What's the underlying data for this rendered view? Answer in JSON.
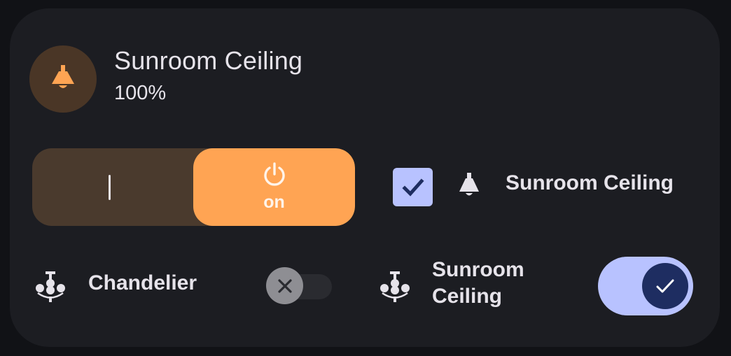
{
  "header": {
    "title": "Sunroom Ceiling",
    "brightness": "100%",
    "icon": "ceiling-lamp-icon",
    "accent_color": "#ffa453"
  },
  "power_switch": {
    "on_label": "on",
    "state": "on",
    "icon": "power-icon"
  },
  "checkbox_row": {
    "label": "Sunroom Ceiling",
    "checked": true,
    "icon": "ceiling-lamp-icon"
  },
  "chandelier_row": {
    "label": "Chandelier",
    "toggle_state": "off",
    "icon": "chandelier-icon"
  },
  "sunroom_toggle_row": {
    "label_line1": "Sunroom",
    "label_line2": "Ceiling",
    "toggle_state": "on",
    "icon": "chandelier-icon"
  }
}
